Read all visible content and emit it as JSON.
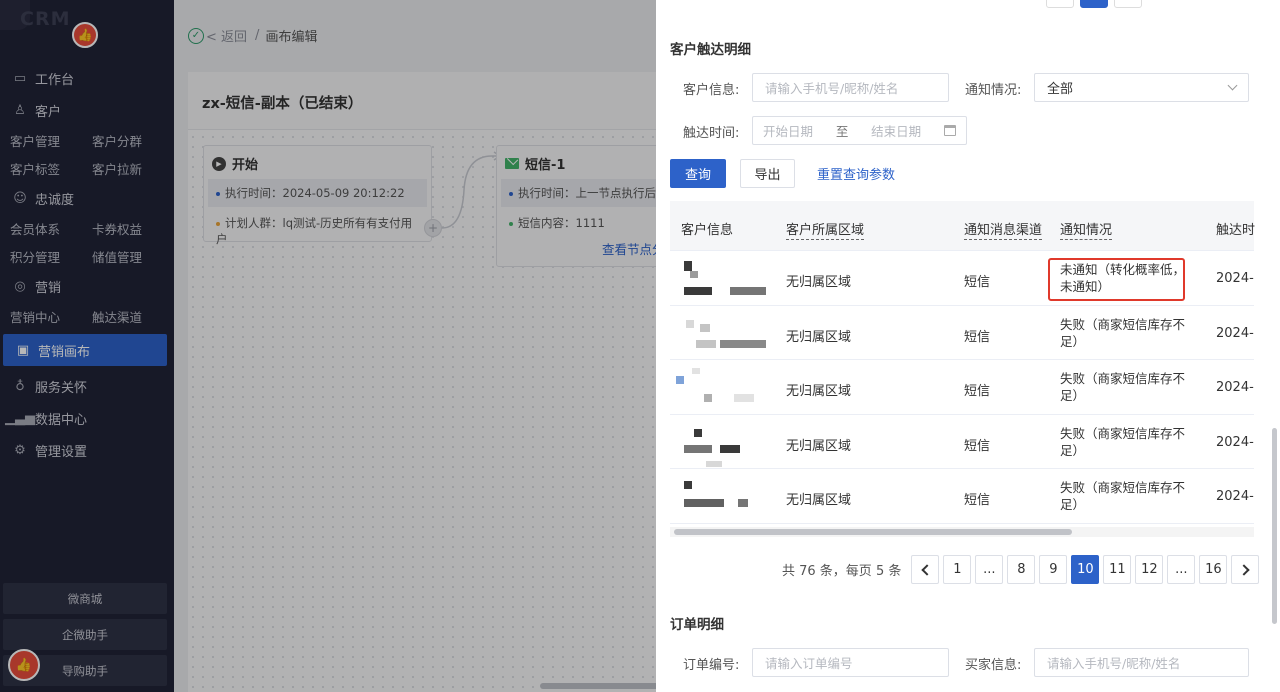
{
  "sidebar": {
    "logo_text": "CRM",
    "nav": {
      "workbench": "工作台",
      "customer": "客户",
      "customer_manage": "客户管理",
      "customer_group": "客户分群",
      "customer_tag": "客户标签",
      "customer_pull": "客户拉新",
      "loyalty": "忠诚度",
      "member_system": "会员体系",
      "coupon_rights": "卡券权益",
      "points_manage": "积分管理",
      "stored_value": "储值管理",
      "marketing": "营销",
      "marketing_center": "营销中心",
      "reach_channel": "触达渠道",
      "marketing_canvas": "营销画布",
      "service_care": "服务关怀",
      "data_center": "数据中心",
      "admin_settings": "管理设置"
    },
    "bottom_buttons": [
      "微商城",
      "企微助手",
      "导购助手"
    ]
  },
  "breadcrumb": {
    "back": "返回",
    "separator": "/",
    "current": "画布编辑"
  },
  "canvas": {
    "title": "zx-短信-副本（已结束）",
    "start_node": {
      "title": "开始",
      "exec_time": "执行时间：2024-05-09 20:12:22",
      "plan_crowd": "计划人群：lq测试-历史所有有支付用户"
    },
    "sms_node": {
      "title": "短信-1",
      "exec_time": "执行时间：上一节点执行后立",
      "sms_content": "短信内容：1111",
      "view_link": "查看节点分析"
    }
  },
  "drawer": {
    "section_title": "客户触达明细",
    "filters": {
      "customer_info_label": "客户信息:",
      "customer_info_placeholder": "请输入手机号/昵称/姓名",
      "notify_status_label": "通知情况:",
      "notify_status_value": "全部",
      "reach_time_label": "触达时间:",
      "start_date_placeholder": "开始日期",
      "date_separator": "至",
      "end_date_placeholder": "结束日期"
    },
    "buttons": {
      "query": "查询",
      "export": "导出",
      "reset": "重置查询参数"
    },
    "table": {
      "columns": [
        "客户信息",
        "客户所属区域",
        "通知消息渠道",
        "通知情况",
        "触达时"
      ],
      "rows": [
        {
          "region": "无归属区域",
          "channel": "短信",
          "notice": "未通知（转化概率低，未通知）",
          "time": "2024-"
        },
        {
          "region": "无归属区域",
          "channel": "短信",
          "notice": "失败（商家短信库存不足）",
          "time": "2024-"
        },
        {
          "region": "无归属区域",
          "channel": "短信",
          "notice": "失败（商家短信库存不足）",
          "time": "2024-"
        },
        {
          "region": "无归属区域",
          "channel": "短信",
          "notice": "失败（商家短信库存不足）",
          "time": "2024-"
        },
        {
          "region": "无归属区域",
          "channel": "短信",
          "notice": "失败（商家短信库存不足）",
          "time": "2024-"
        }
      ]
    },
    "pagination": {
      "total_text": "共 76 条，每页 5 条",
      "pages": [
        "1",
        "...",
        "8",
        "9",
        "10",
        "11",
        "12",
        "...",
        "16"
      ],
      "current": "10"
    },
    "order_section": {
      "title": "订单明细",
      "order_no_label": "订单编号:",
      "order_no_placeholder": "请输入订单编号",
      "buyer_label": "买家信息:",
      "buyer_placeholder": "请输入手机号/昵称/姓名"
    }
  },
  "colors": {
    "accent": "#2d62c9",
    "sidebar_bg": "#212337",
    "highlight": "#e0392b"
  }
}
